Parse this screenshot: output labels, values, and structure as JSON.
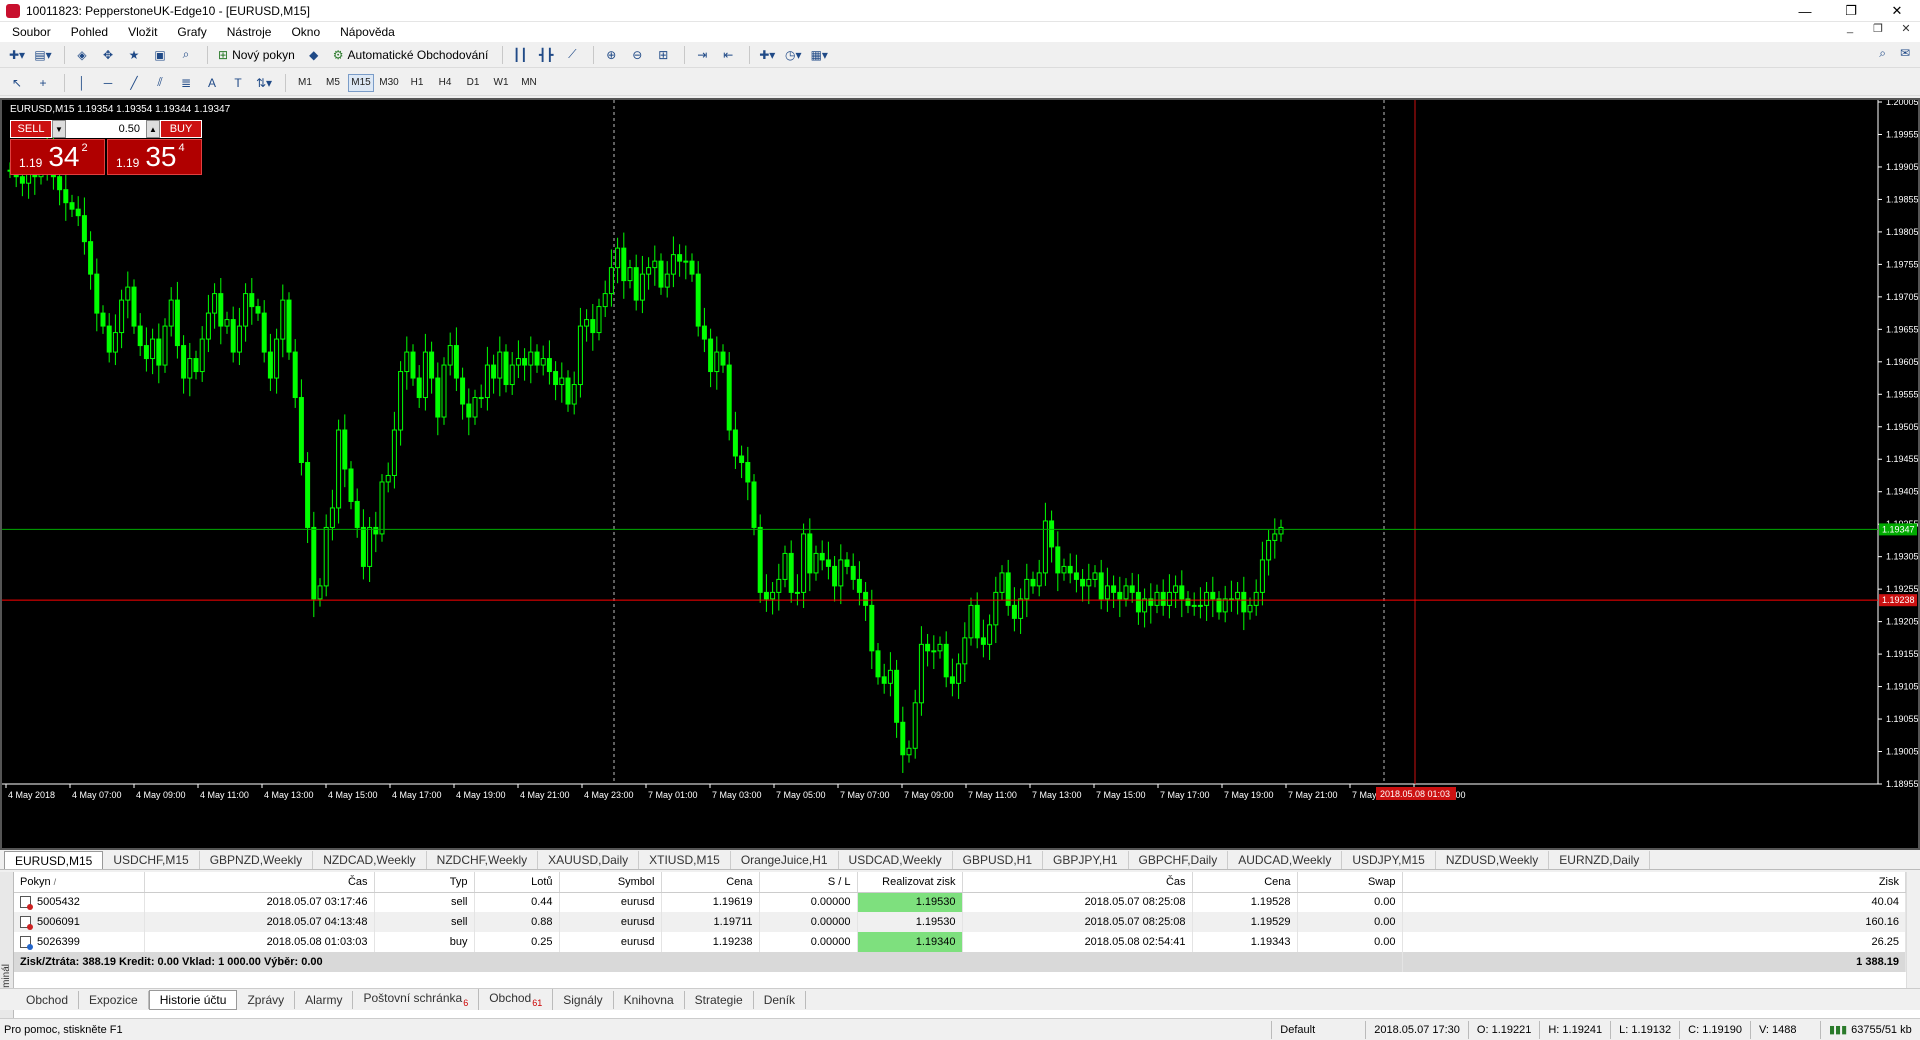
{
  "window": {
    "title": "10011823: PepperstoneUK-Edge10 - [EURUSD,M15]",
    "buttons": [
      "—",
      "❐",
      "✕"
    ]
  },
  "menu": [
    "Soubor",
    "Pohled",
    "Vložit",
    "Grafy",
    "Nástroje",
    "Okno",
    "Nápověda"
  ],
  "mdi_buttons": [
    "_",
    "❐",
    "✕"
  ],
  "toolbar": {
    "new_order": "Nový pokyn",
    "autotrading": "Automatické Obchodování"
  },
  "timeframes": [
    "M1",
    "M5",
    "M15",
    "M30",
    "H1",
    "H4",
    "D1",
    "W1",
    "MN"
  ],
  "active_timeframe": "M15",
  "chart": {
    "header": "EURUSD,M15  1.19354 1.19354 1.19344 1.19347",
    "one_click": {
      "sell": "SELL",
      "buy": "BUY",
      "lot": "0.50",
      "sell_small": "1.19",
      "sell_big": "34",
      "sell_sup": "2",
      "buy_small": "1.19",
      "buy_big": "35",
      "buy_sup": "4"
    },
    "bid_label": "1.19347",
    "order_label": "1.19238",
    "crosshair_time": "2018.05.08 01:03"
  },
  "chart_data": {
    "type": "candlestick",
    "ylim": [
      1.18955,
      1.20005
    ],
    "price_ticks": [
      "1.20005",
      "1.19955",
      "1.19905",
      "1.19855",
      "1.19805",
      "1.19755",
      "1.19705",
      "1.19655",
      "1.19605",
      "1.19555",
      "1.19505",
      "1.19455",
      "1.19405",
      "1.19355",
      "1.19305",
      "1.19255",
      "1.19205",
      "1.19155",
      "1.19105",
      "1.19055",
      "1.19005",
      "1.18955"
    ],
    "time_ticks": [
      "4 May 2018",
      "4 May 07:00",
      "4 May 09:00",
      "4 May 11:00",
      "4 May 13:00",
      "4 May 15:00",
      "4 May 17:00",
      "4 May 19:00",
      "4 May 21:00",
      "4 May 23:00",
      "7 May 01:00",
      "7 May 03:00",
      "7 May 05:00",
      "7 May 07:00",
      "7 May 09:00",
      "7 May 11:00",
      "7 May 13:00",
      "7 May 15:00",
      "7 May 17:00",
      "7 May 19:00",
      "7 May 21:00",
      "7 May",
      "8 May 03:00"
    ],
    "closes": [
      1.199,
      1.1989,
      1.1988,
      1.1991,
      1.1989,
      1.199,
      1.1993,
      1.1989,
      1.1987,
      1.1985,
      1.1984,
      1.1983,
      1.1979,
      1.1974,
      1.1968,
      1.1966,
      1.1962,
      1.1965,
      1.197,
      1.1972,
      1.1966,
      1.1963,
      1.1961,
      1.1964,
      1.196,
      1.1966,
      1.197,
      1.1963,
      1.1958,
      1.1961,
      1.1959,
      1.1964,
      1.1968,
      1.1971,
      1.1966,
      1.1967,
      1.1962,
      1.1966,
      1.1971,
      1.1969,
      1.1968,
      1.1962,
      1.1958,
      1.1964,
      1.197,
      1.1962,
      1.1955,
      1.1945,
      1.1935,
      1.1924,
      1.1926,
      1.1935,
      1.1938,
      1.195,
      1.1944,
      1.1939,
      1.1935,
      1.1929,
      1.1935,
      1.1934,
      1.1942,
      1.1943,
      1.195,
      1.1959,
      1.1962,
      1.1958,
      1.1955,
      1.1962,
      1.1958,
      1.1952,
      1.196,
      1.1963,
      1.1958,
      1.1954,
      1.1952,
      1.1955,
      1.1955,
      1.196,
      1.1958,
      1.1962,
      1.1957,
      1.196,
      1.1961,
      1.196,
      1.1962,
      1.196,
      1.1961,
      1.1959,
      1.1957,
      1.1958,
      1.1954,
      1.1957,
      1.1966,
      1.1967,
      1.1965,
      1.1969,
      1.1971,
      1.1975,
      1.1978,
      1.1973,
      1.1975,
      1.197,
      1.1974,
      1.1975,
      1.1976,
      1.1972,
      1.1974,
      1.1977,
      1.1976,
      1.1976,
      1.1974,
      1.1966,
      1.1964,
      1.1959,
      1.1962,
      1.196,
      1.195,
      1.1946,
      1.1945,
      1.1942,
      1.1935,
      1.1925,
      1.1924,
      1.1925,
      1.1927,
      1.1931,
      1.1925,
      1.1925,
      1.1934,
      1.1928,
      1.1931,
      1.193,
      1.1929,
      1.1926,
      1.193,
      1.1929,
      1.1927,
      1.1925,
      1.1923,
      1.1916,
      1.1912,
      1.1911,
      1.1913,
      1.1905,
      1.19,
      1.1901,
      1.1908,
      1.1917,
      1.1916,
      1.1916,
      1.1917,
      1.1912,
      1.1911,
      1.1914,
      1.1918,
      1.1923,
      1.1918,
      1.1917,
      1.192,
      1.1925,
      1.1928,
      1.1923,
      1.1921,
      1.1924,
      1.1927,
      1.1926,
      1.1928,
      1.1936,
      1.1932,
      1.1928,
      1.1929,
      1.1928,
      1.1927,
      1.1926,
      1.1927,
      1.1928,
      1.1924,
      1.1926,
      1.1925,
      1.1924,
      1.1926,
      1.1925,
      1.1922,
      1.1924,
      1.1923,
      1.1925,
      1.1923,
      1.1925,
      1.1926,
      1.1924,
      1.1923,
      1.1923,
      1.1923,
      1.1925,
      1.1924,
      1.1922,
      1.1924,
      1.1924,
      1.1925,
      1.1922,
      1.1923,
      1.1925,
      1.193,
      1.1933,
      1.1934,
      1.1935
    ]
  },
  "period_tabs": [
    "EURUSD,M15",
    "USDCHF,M15",
    "GBPNZD,Weekly",
    "NZDCAD,Weekly",
    "NZDCHF,Weekly",
    "XAUUSD,Daily",
    "XTIUSD,M15",
    "OrangeJuice,H1",
    "USDCAD,Weekly",
    "GBPUSD,H1",
    "GBPJPY,H1",
    "GBPCHF,Daily",
    "AUDCAD,Weekly",
    "USDJPY,M15",
    "NZDUSD,Weekly",
    "EURNZD,Daily"
  ],
  "terminal": {
    "side_label": "Terminál",
    "headers": [
      "Pokyn",
      "/",
      "Čas",
      "Typ",
      "Lotů",
      "Symbol",
      "Cena",
      "S / L",
      "Realizovat zisk",
      "Čas",
      "Cena",
      "Swap",
      "Zisk"
    ],
    "rows": [
      {
        "ticket": "5005432",
        "open_time": "2018.05.07 03:17:46",
        "type": "sell",
        "lots": "0.44",
        "symbol": "eurusd",
        "price": "1.19619",
        "sl": "0.00000",
        "tp": "1.19530",
        "close_time": "2018.05.07 08:25:08",
        "close_price": "1.19528",
        "swap": "0.00",
        "profit": "40.04"
      },
      {
        "ticket": "5006091",
        "open_time": "2018.05.07 04:13:48",
        "type": "sell",
        "lots": "0.88",
        "symbol": "eurusd",
        "price": "1.19711",
        "sl": "0.00000",
        "tp": "1.19530",
        "close_time": "2018.05.07 08:25:08",
        "close_price": "1.19529",
        "swap": "0.00",
        "profit": "160.16"
      },
      {
        "ticket": "5026399",
        "open_time": "2018.05.08 01:03:03",
        "type": "buy",
        "lots": "0.25",
        "symbol": "eurusd",
        "price": "1.19238",
        "sl": "0.00000",
        "tp": "1.19340",
        "close_time": "2018.05.08 02:54:41",
        "close_price": "1.19343",
        "swap": "0.00",
        "profit": "26.25"
      }
    ],
    "summary": "Zisk/Ztráta: 388.19  Kredit: 0.00  Vklad: 1 000.00  Výběr: 0.00",
    "summary_total": "1 388.19"
  },
  "bottom_tabs": [
    {
      "label": "Obchod",
      "count": ""
    },
    {
      "label": "Expozice",
      "count": ""
    },
    {
      "label": "Historie účtu",
      "count": ""
    },
    {
      "label": "Zprávy",
      "count": ""
    },
    {
      "label": "Alarmy",
      "count": ""
    },
    {
      "label": "Poštovní schránka",
      "count": "6"
    },
    {
      "label": "Obchod",
      "count": "61"
    },
    {
      "label": "Signály",
      "count": ""
    },
    {
      "label": "Knihovna",
      "count": ""
    },
    {
      "label": "Strategie",
      "count": ""
    },
    {
      "label": "Deník",
      "count": ""
    }
  ],
  "active_bottom_tab": "Historie účtu",
  "status": {
    "help": "Pro pomoc, stiskněte F1",
    "profile": "Default",
    "time": "2018.05.07 17:30",
    "open": "O: 1.19221",
    "high": "H: 1.19241",
    "low": "L: 1.19132",
    "close": "C: 1.19190",
    "volume": "V: 1488",
    "traffic": "63755/51 kb"
  },
  "colors": {
    "bull": "#00ff00",
    "bear": "#00ff00",
    "bid_line": "#00aa00",
    "order_line": "#ff0000",
    "bg": "#000000",
    "tp_cell": "#7ee07e"
  }
}
